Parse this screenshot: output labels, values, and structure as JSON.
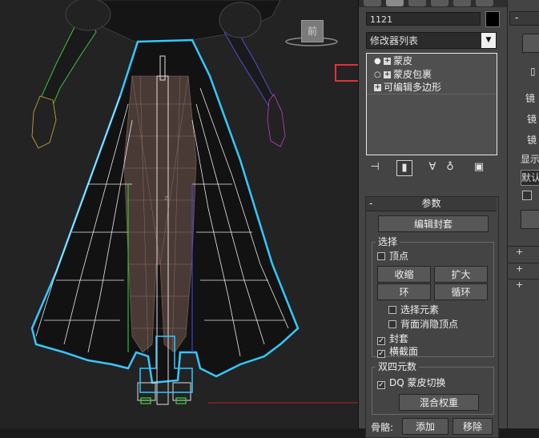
{
  "viewport": {
    "view_label": "前",
    "axis_marker": "z"
  },
  "command_panel": {
    "object_name": "1121",
    "object_color": "#000000",
    "modifier_list": "修改器列表",
    "stack": [
      {
        "label": "蒙皮",
        "icon": "lightbulb-icon",
        "expand": "+"
      },
      {
        "label": "蒙皮包裹",
        "icon": "lightbulb-icon",
        "expand": "+"
      },
      {
        "label": "可编辑多边形",
        "icon": "",
        "expand": "+"
      }
    ],
    "stack_tools": [
      "pin-stack-icon",
      "show-end-result-icon",
      "make-unique-icon",
      "remove-modifier-icon",
      "configure-sets-icon"
    ],
    "rollout": {
      "collapse": "-",
      "title": "参数",
      "edit_envelope": "编辑封套",
      "select_group": "选择",
      "vertex": "顶点",
      "shrink": "收缩",
      "grow": "扩大",
      "ring": "环",
      "loop": "循环",
      "select_element": "选择元素",
      "backface_cull": "背面消隐顶点",
      "envelope": "封套",
      "cross_section": "横截面",
      "dq_group": "双四元数",
      "dq_toggle": "DQ 蒙皮切换",
      "blend_weights": "混合权重",
      "bones_label": "骨骼:",
      "add": "添加",
      "remove": "移除"
    },
    "check": "✓"
  },
  "right_panel": {
    "collapse": "-",
    "labels": [
      "镜",
      "镜",
      "镜",
      "显示"
    ],
    "field": "默认",
    "expanders": [
      "+",
      "+",
      "+"
    ]
  },
  "colors": {
    "highlight_box": "#e0323a",
    "selection_outline": "#35c8ff"
  }
}
